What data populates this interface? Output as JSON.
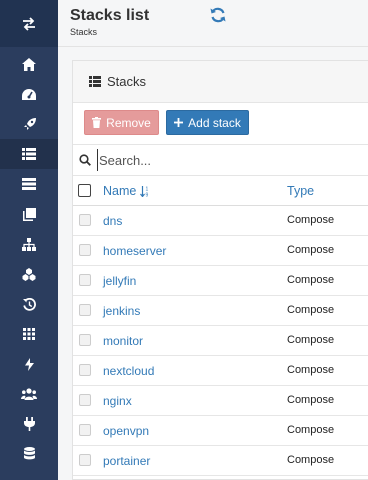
{
  "header": {
    "title": "Stacks list",
    "breadcrumb": "Stacks"
  },
  "panel": {
    "title": "Stacks"
  },
  "actions": {
    "remove_label": "Remove",
    "add_label": "Add stack"
  },
  "search": {
    "placeholder": "Search...",
    "value": ""
  },
  "table": {
    "columns": [
      "Name",
      "Type"
    ],
    "rows": [
      {
        "name": "dns",
        "type": "Compose"
      },
      {
        "name": "homeserver",
        "type": "Compose"
      },
      {
        "name": "jellyfin",
        "type": "Compose"
      },
      {
        "name": "jenkins",
        "type": "Compose"
      },
      {
        "name": "monitor",
        "type": "Compose"
      },
      {
        "name": "nextcloud",
        "type": "Compose"
      },
      {
        "name": "nginx",
        "type": "Compose"
      },
      {
        "name": "openvpn",
        "type": "Compose"
      },
      {
        "name": "portainer",
        "type": "Compose"
      }
    ]
  },
  "sidebar": {
    "icons": [
      "home-icon",
      "dashboard-icon",
      "rocket-icon",
      "stacks-icon",
      "services-icon",
      "containers-icon",
      "networks-icon",
      "volumes-icon",
      "events-icon",
      "apps-icon",
      "lightning-icon",
      "users-icon",
      "plug-icon",
      "database-icon"
    ],
    "active": "stacks-icon"
  },
  "colors": {
    "sidebar": "#2b3d5e",
    "accent": "#337ab7",
    "danger": "#e59b9b"
  }
}
